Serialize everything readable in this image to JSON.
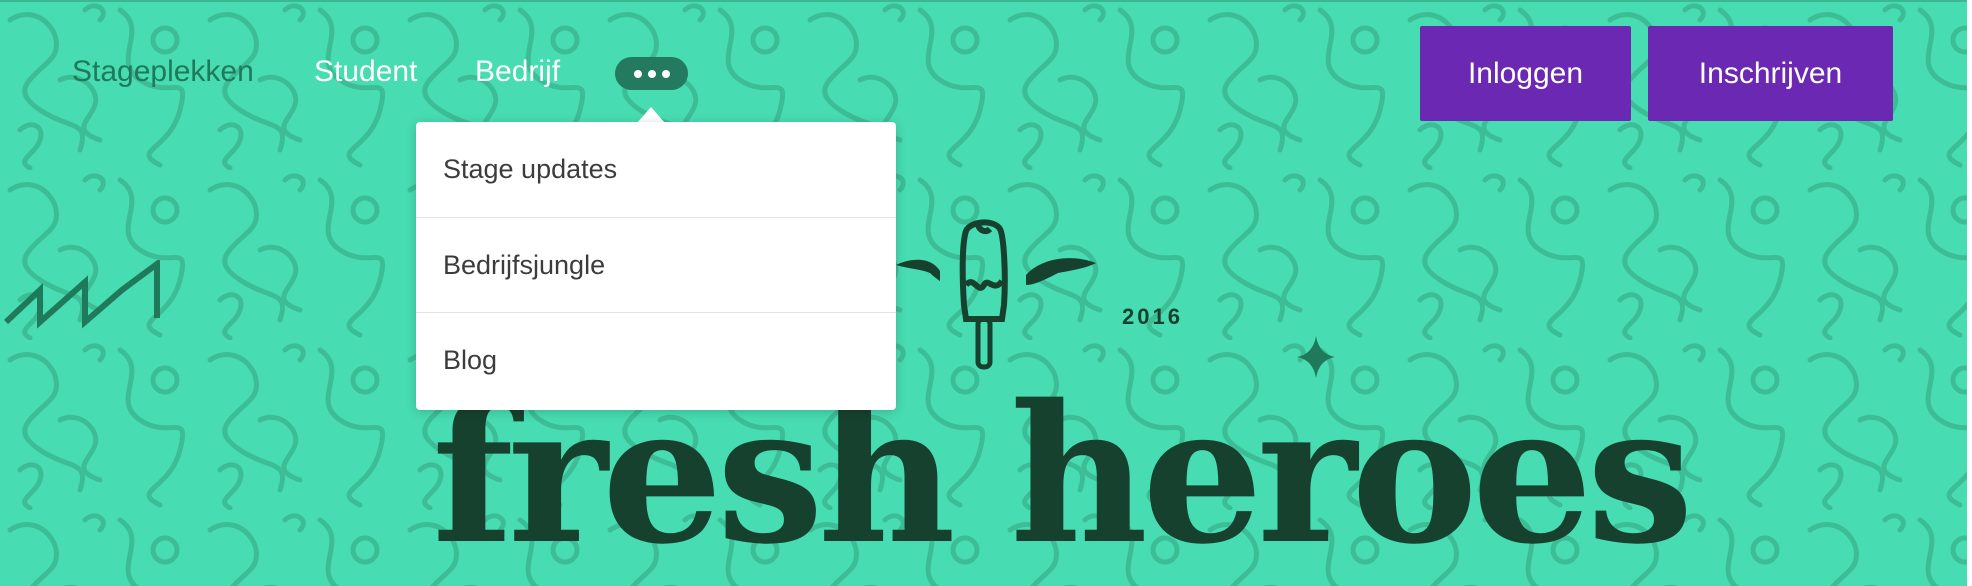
{
  "nav": {
    "links": [
      {
        "label": "Stageplekken"
      },
      {
        "label": "Student"
      },
      {
        "label": "Bedrijf"
      }
    ],
    "more_icon": "more-dots-icon"
  },
  "auth": {
    "login_label": "Inloggen",
    "signup_label": "Inschrijven"
  },
  "dropdown": {
    "items": [
      {
        "label": "Stage updates"
      },
      {
        "label": "Bedrijfsjungle"
      },
      {
        "label": "Blog"
      }
    ]
  },
  "hero": {
    "title": "fresh heroes",
    "year": "2016",
    "logo_icon": "winged-popsicle-icon"
  },
  "colors": {
    "background": "#47dcb1",
    "accent_purple": "#6a28b3",
    "dark_green": "#17412f",
    "nav_active": "#1f7a5c"
  }
}
